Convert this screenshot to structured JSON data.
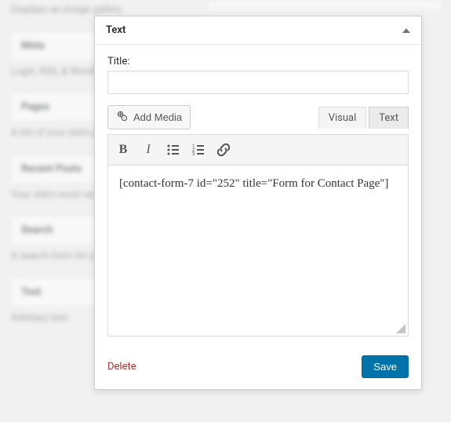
{
  "sidebar": {
    "items": [
      {
        "title": "Meta",
        "desc": "Login, RSS, & WordPress links."
      },
      {
        "title": "Pages",
        "desc": "A list of your site's pages."
      },
      {
        "title": "Recent Posts",
        "desc": "Your site's most recent posts."
      },
      {
        "title": "Search",
        "desc": "A search form for your site."
      },
      {
        "title": "Text",
        "desc": "Arbitrary text."
      }
    ],
    "top_desc": "Displays an image gallery."
  },
  "widget": {
    "header_title": "Text",
    "title_label": "Title:",
    "title_value": "",
    "add_media_label": "Add Media",
    "tabs": {
      "visual": "Visual",
      "text": "Text"
    },
    "active_tab": "text",
    "content": "[contact-form-7 id=\"252\" title=\"Form for Contact Page\"]",
    "delete_label": "Delete",
    "save_label": "Save"
  }
}
